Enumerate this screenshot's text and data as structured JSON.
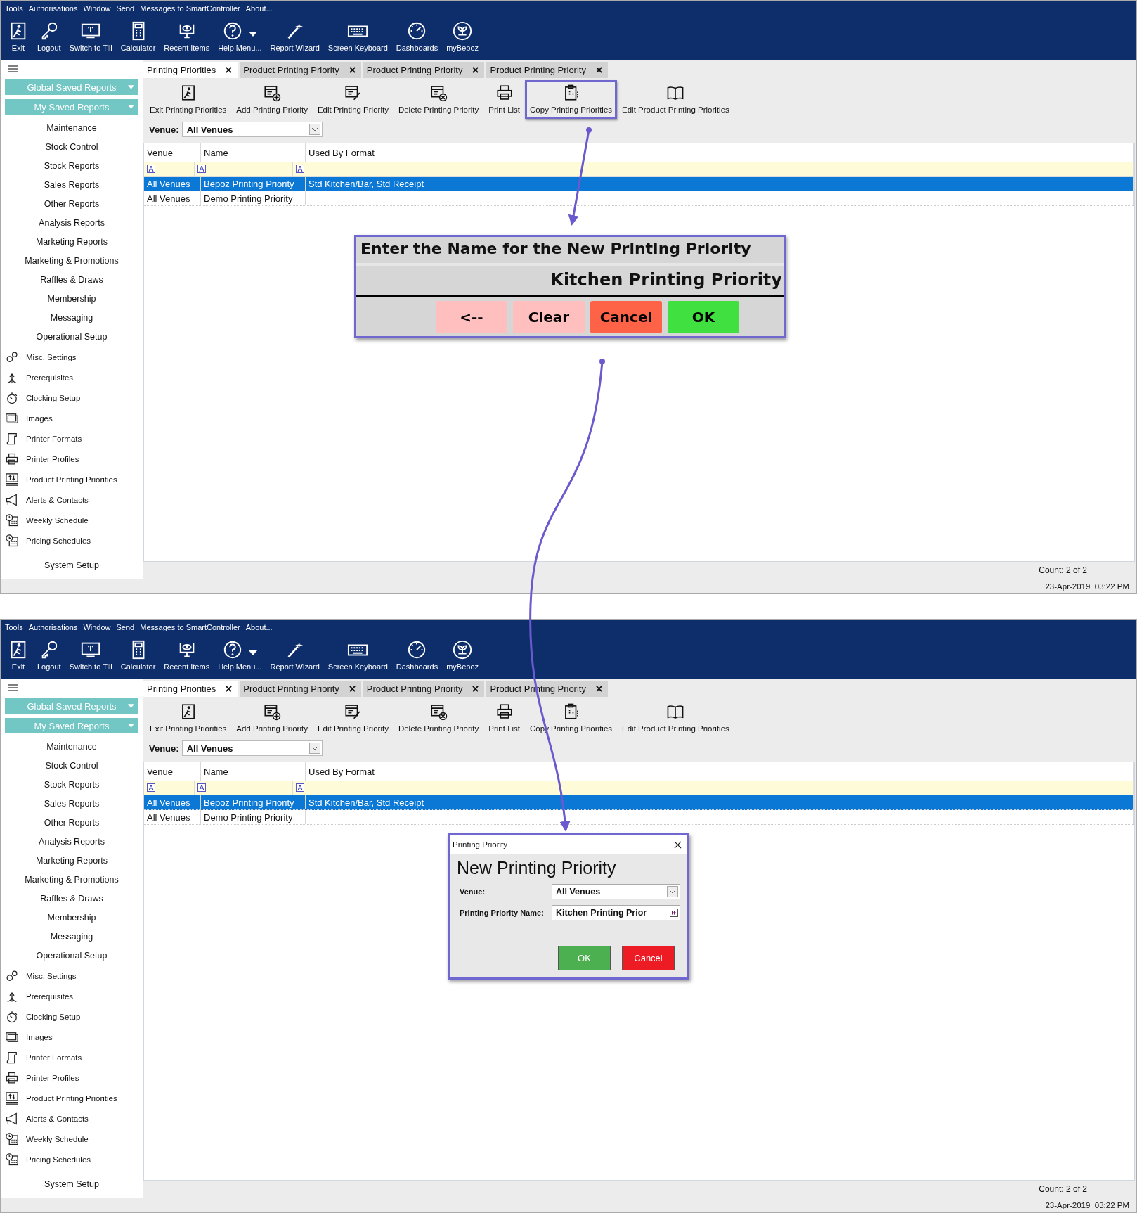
{
  "screens": [
    {
      "menu": [
        "Tools",
        "Authorisations",
        "Window",
        "Send",
        "Messages to SmartController",
        "About..."
      ],
      "toolbar": [
        {
          "label": "Exit",
          "kind": "button"
        },
        {
          "label": "Logout",
          "kind": "button"
        },
        {
          "label": "Switch to Till",
          "kind": "button"
        },
        {
          "label": "Calculator",
          "kind": "button"
        },
        {
          "label": "Recent Items",
          "kind": "button"
        },
        {
          "label": "Help Menu...",
          "kind": "dropdown"
        },
        {
          "label": "Report Wizard",
          "kind": "button"
        },
        {
          "label": "Screen Keyboard",
          "kind": "button"
        },
        {
          "label": "Dashboards",
          "kind": "button"
        },
        {
          "label": "myBepoz",
          "kind": "button"
        }
      ],
      "sidebar": [
        {
          "label": "Global Saved Reports",
          "kind": "dropdown"
        },
        {
          "label": "My Saved Reports",
          "kind": "dropdown"
        },
        {
          "label": "Maintenance",
          "kind": "category"
        },
        {
          "label": "Stock Control",
          "kind": "category"
        },
        {
          "label": "Stock Reports",
          "kind": "category"
        },
        {
          "label": "Sales Reports",
          "kind": "category"
        },
        {
          "label": "Other Reports",
          "kind": "category"
        },
        {
          "label": "Analysis Reports",
          "kind": "category"
        },
        {
          "label": "Marketing Reports",
          "kind": "category"
        },
        {
          "label": "Marketing & Promotions",
          "kind": "category"
        },
        {
          "label": "Raffles & Draws",
          "kind": "category"
        },
        {
          "label": "Membership",
          "kind": "category"
        },
        {
          "label": "Messaging",
          "kind": "category"
        },
        {
          "label": "Operational Setup",
          "kind": "category"
        },
        {
          "label": "Misc. Settings",
          "kind": "link"
        },
        {
          "label": "Prerequisites",
          "kind": "link"
        },
        {
          "label": "Clocking Setup",
          "kind": "link"
        },
        {
          "label": "Images",
          "kind": "link"
        },
        {
          "label": "Printer Formats",
          "kind": "link"
        },
        {
          "label": "Printer Profiles",
          "kind": "link"
        },
        {
          "label": "Product Printing Priorities",
          "kind": "link"
        },
        {
          "label": "Alerts & Contacts",
          "kind": "link"
        },
        {
          "label": "Weekly Schedule",
          "kind": "link"
        },
        {
          "label": "Pricing Schedules",
          "kind": "link"
        },
        {
          "label": "System Setup",
          "kind": "footer"
        }
      ],
      "tabs": [
        {
          "label": "Printing Priorities",
          "selected": true
        },
        {
          "label": "Product Printing Priority",
          "selected": false
        },
        {
          "label": "Product Printing Priority",
          "selected": false
        },
        {
          "label": "Product Printing Priority",
          "selected": false
        }
      ],
      "actions": [
        {
          "label": "Exit Printing Priorities",
          "highlighted": false
        },
        {
          "label": "Add Printing Priority",
          "highlighted": false
        },
        {
          "label": "Edit Printing Priority",
          "highlighted": false
        },
        {
          "label": "Delete Printing Priority",
          "highlighted": false
        },
        {
          "label": "Print List",
          "highlighted": false
        },
        {
          "label": "Copy Printing Priorities",
          "highlighted": true
        },
        {
          "label": "Edit Product Printing Priorities",
          "highlighted": false
        }
      ],
      "venue": {
        "label": "Venue:",
        "value": "All Venues"
      },
      "grid": {
        "columns": [
          "Venue",
          "Name",
          "Used By Format"
        ],
        "rows": [
          {
            "cells": [
              "All Venues",
              "Bepoz Printing Priority",
              "Std Kitchen/Bar, Std Receipt"
            ],
            "selected": true
          },
          {
            "cells": [
              "All Venues",
              "Demo Printing Priority",
              ""
            ],
            "selected": false
          }
        ]
      },
      "status": {
        "count": "Count: 2 of 2",
        "datetime": "23-Apr-2019  03:22 PM"
      },
      "dialog": {
        "kind": "keypad",
        "prompt": "Enter the Name for the New Printing Priority",
        "value": "Kitchen Printing Priority",
        "buttons": [
          {
            "label": "<--",
            "color": "#ffbfbf"
          },
          {
            "label": "Clear",
            "color": "#ffbfbf"
          },
          {
            "label": "Cancel",
            "color": "#ff6347"
          },
          {
            "label": "OK",
            "color": "#40e040"
          }
        ]
      }
    },
    {
      "menu": [
        "Tools",
        "Authorisations",
        "Window",
        "Send",
        "Messages to SmartController",
        "About..."
      ],
      "toolbar": [
        {
          "label": "Exit",
          "kind": "button"
        },
        {
          "label": "Logout",
          "kind": "button"
        },
        {
          "label": "Switch to Till",
          "kind": "button"
        },
        {
          "label": "Calculator",
          "kind": "button"
        },
        {
          "label": "Recent Items",
          "kind": "button"
        },
        {
          "label": "Help Menu...",
          "kind": "dropdown"
        },
        {
          "label": "Report Wizard",
          "kind": "button"
        },
        {
          "label": "Screen Keyboard",
          "kind": "button"
        },
        {
          "label": "Dashboards",
          "kind": "button"
        },
        {
          "label": "myBepoz",
          "kind": "button"
        }
      ],
      "sidebar": [
        {
          "label": "Global Saved Reports",
          "kind": "dropdown"
        },
        {
          "label": "My Saved Reports",
          "kind": "dropdown"
        },
        {
          "label": "Maintenance",
          "kind": "category"
        },
        {
          "label": "Stock Control",
          "kind": "category"
        },
        {
          "label": "Stock Reports",
          "kind": "category"
        },
        {
          "label": "Sales Reports",
          "kind": "category"
        },
        {
          "label": "Other Reports",
          "kind": "category"
        },
        {
          "label": "Analysis Reports",
          "kind": "category"
        },
        {
          "label": "Marketing Reports",
          "kind": "category"
        },
        {
          "label": "Marketing & Promotions",
          "kind": "category"
        },
        {
          "label": "Raffles & Draws",
          "kind": "category"
        },
        {
          "label": "Membership",
          "kind": "category"
        },
        {
          "label": "Messaging",
          "kind": "category"
        },
        {
          "label": "Operational Setup",
          "kind": "category"
        },
        {
          "label": "Misc. Settings",
          "kind": "link"
        },
        {
          "label": "Prerequisites",
          "kind": "link"
        },
        {
          "label": "Clocking Setup",
          "kind": "link"
        },
        {
          "label": "Images",
          "kind": "link"
        },
        {
          "label": "Printer Formats",
          "kind": "link"
        },
        {
          "label": "Printer Profiles",
          "kind": "link"
        },
        {
          "label": "Product Printing Priorities",
          "kind": "link"
        },
        {
          "label": "Alerts & Contacts",
          "kind": "link"
        },
        {
          "label": "Weekly Schedule",
          "kind": "link"
        },
        {
          "label": "Pricing Schedules",
          "kind": "link"
        },
        {
          "label": "System Setup",
          "kind": "footer"
        }
      ],
      "tabs": [
        {
          "label": "Printing Priorities",
          "selected": true
        },
        {
          "label": "Product Printing Priority",
          "selected": false
        },
        {
          "label": "Product Printing Priority",
          "selected": false
        },
        {
          "label": "Product Printing Priority",
          "selected": false
        }
      ],
      "actions": [
        {
          "label": "Exit Printing Priorities",
          "highlighted": false
        },
        {
          "label": "Add Printing Priority",
          "highlighted": false
        },
        {
          "label": "Edit Printing Priority",
          "highlighted": false
        },
        {
          "label": "Delete Printing Priority",
          "highlighted": false
        },
        {
          "label": "Print List",
          "highlighted": false
        },
        {
          "label": "Copy Printing Priorities",
          "highlighted": false
        },
        {
          "label": "Edit Product Printing Priorities",
          "highlighted": false
        }
      ],
      "venue": {
        "label": "Venue:",
        "value": "All Venues"
      },
      "grid": {
        "columns": [
          "Venue",
          "Name",
          "Used By Format"
        ],
        "rows": [
          {
            "cells": [
              "All Venues",
              "Bepoz Printing Priority",
              "Std Kitchen/Bar, Std Receipt"
            ],
            "selected": true
          },
          {
            "cells": [
              "All Venues",
              "Demo Printing Priority",
              ""
            ],
            "selected": false
          }
        ]
      },
      "status": {
        "count": "Count: 2 of 2",
        "datetime": "23-Apr-2019  03:22 PM"
      },
      "dialog": {
        "kind": "form",
        "title": "Printing Priority",
        "heading": "New Printing Priority",
        "fields": [
          {
            "label": "Venue:",
            "value": "All Venues",
            "kind": "select"
          },
          {
            "label": "Printing Priority Name:",
            "value": "Kitchen Printing Prior",
            "kind": "text"
          }
        ],
        "buttons": [
          {
            "label": "OK",
            "color": "#4caf50"
          },
          {
            "label": "Cancel",
            "color": "#ed1c24"
          }
        ]
      }
    }
  ]
}
